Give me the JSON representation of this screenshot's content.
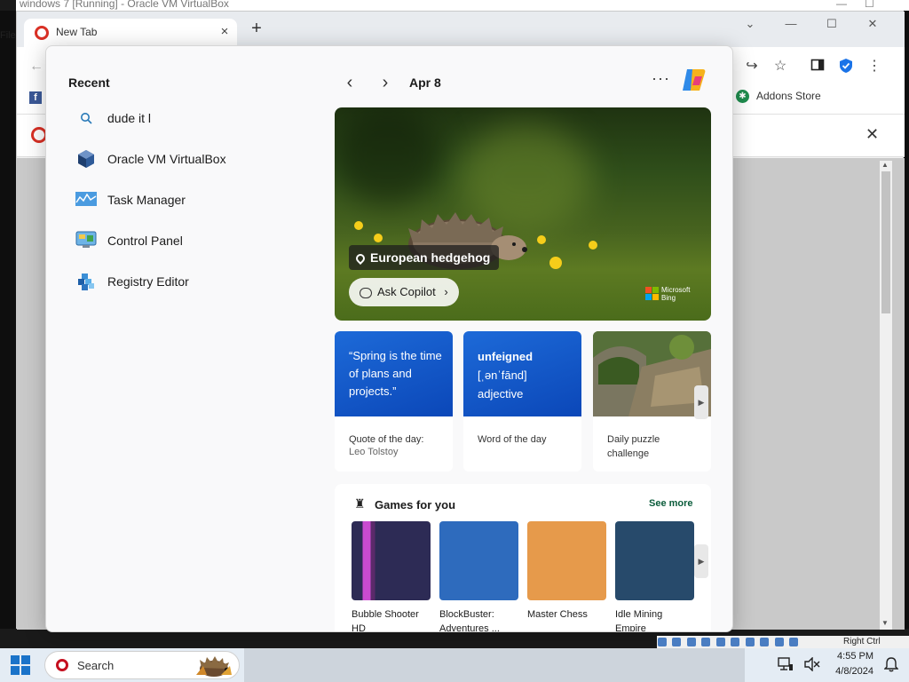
{
  "vbox": {
    "window_title": "windows 7 [Running] - Oracle VM VirtualBox",
    "menu_file": "File",
    "status_host_key": "Right Ctrl"
  },
  "browser": {
    "tab_title": "New Tab",
    "tab_close": "×",
    "new_tab": "+",
    "window_controls": {
      "dropdown": "⌄",
      "minimize": "—",
      "maximize": "☐",
      "close": "✕"
    },
    "toolbar_icons": [
      "back-icon",
      "share-icon",
      "favorite-star-icon",
      "sidebar-icon",
      "shield-icon",
      "more-icon"
    ],
    "favorites": {
      "addons_store": "Addons Store",
      "facebook_glyph": "f",
      "addons_glyph": "✱"
    },
    "infobar_close": "✕"
  },
  "flyout": {
    "recent_title": "Recent",
    "recent_items": [
      {
        "label": "dude it l",
        "icon": "search-icon"
      },
      {
        "label": "Oracle VM VirtualBox",
        "icon": "virtualbox-icon"
      },
      {
        "label": "Task Manager",
        "icon": "task-manager-icon"
      },
      {
        "label": "Control Panel",
        "icon": "control-panel-icon"
      },
      {
        "label": "Registry Editor",
        "icon": "registry-editor-icon"
      }
    ],
    "date": "Apr 8",
    "more": "···",
    "hero": {
      "caption": "European hedgehog",
      "ask_copilot": "Ask Copilot",
      "ask_chevron": "›",
      "bing_line1": "Microsoft",
      "bing_line2": "Bing"
    },
    "cards": [
      {
        "top_text": "“Spring is the time of plans and projects.”",
        "foot1": "Quote of the day:",
        "foot2": "Leo Tolstoy"
      },
      {
        "word": "unfeigned",
        "pron": "[ˌənˈfānd]",
        "pos": "adjective",
        "foot1": "Word of the day"
      },
      {
        "foot1": "Daily puzzle",
        "foot2": "challenge"
      }
    ],
    "games": {
      "title": "Games for you",
      "see_more": "See more",
      "items": [
        {
          "name": "Bubble Shooter HD",
          "color": "#2d2b55"
        },
        {
          "name": "BlockBuster: Adventures ...",
          "color": "#2e6bbd"
        },
        {
          "name": "Master Chess",
          "color": "#e69a4b"
        },
        {
          "name": "Idle Mining Empire",
          "color": "#274a6b"
        }
      ]
    }
  },
  "taskbar": {
    "search_label": "Search",
    "time": "4:55 PM",
    "date": "4/8/2024"
  },
  "colors": {
    "accent_blue": "#1a73c9",
    "card_blue": "#1d6ad8",
    "see_more_green": "#0b5c3b",
    "edge_shield": "#1a73e8"
  }
}
